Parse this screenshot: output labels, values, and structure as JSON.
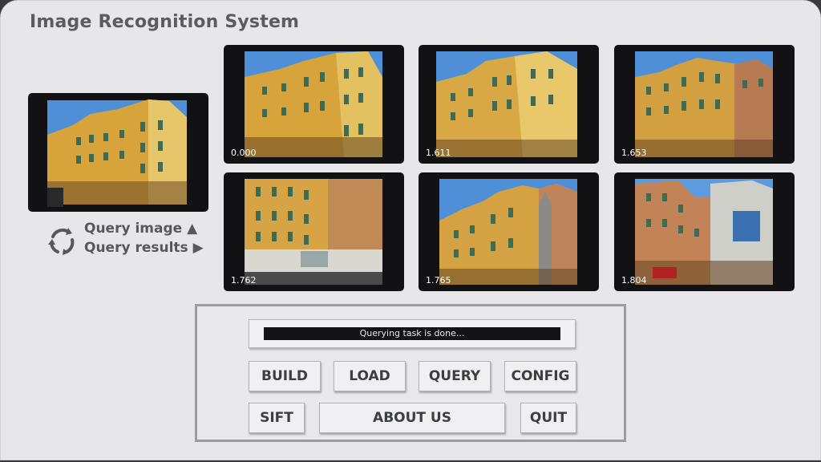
{
  "app": {
    "title": "Image Recognition System"
  },
  "query_image": {
    "label": "Query image ▲"
  },
  "results_label": "Query results ▶",
  "results": [
    {
      "score": "0.000"
    },
    {
      "score": "1.611"
    },
    {
      "score": "1.653"
    },
    {
      "score": "1.762"
    },
    {
      "score": "1.765"
    },
    {
      "score": "1.804"
    }
  ],
  "status": {
    "text": "Querying task is done..."
  },
  "buttons": {
    "build": "BUILD",
    "load": "LOAD",
    "query": "QUERY",
    "config": "CONFIG",
    "sift": "SIFT",
    "about": "ABOUT US",
    "quit": "QUIT"
  },
  "colors": {
    "window_bg": "#e7e7e9",
    "thumb_frame": "#121214",
    "sky": "#4f8fd8",
    "facade": "#d7a43c",
    "text": "#5a5c60"
  },
  "icons": {
    "legend": "refresh-cycle-icon"
  }
}
